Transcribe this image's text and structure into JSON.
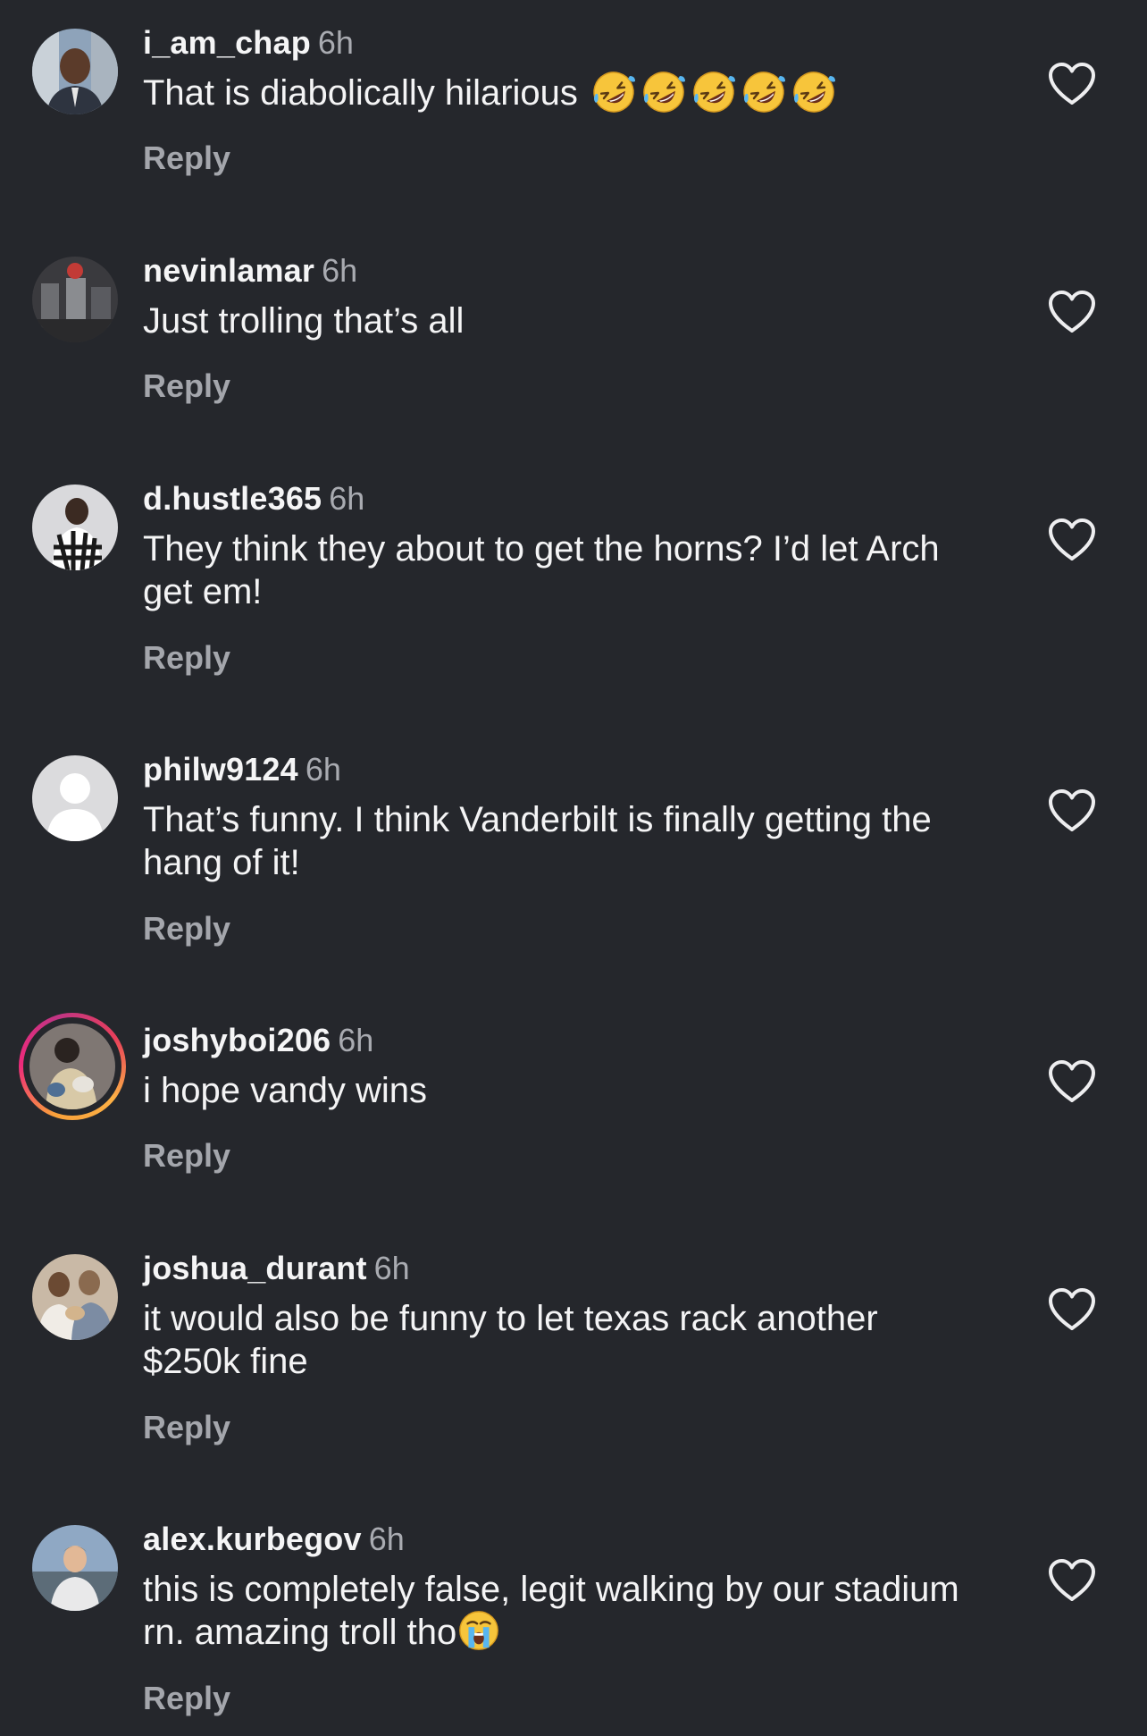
{
  "colors": {
    "background": "#25272c",
    "text": "#f4f4f5",
    "muted": "#a4a6ac",
    "story_ring": "#ee2a7b"
  },
  "icons": {
    "like": "heart-outline-icon",
    "laugh": "rolling-on-floor-laughing-emoji",
    "cry": "loudly-crying-face-emoji"
  },
  "comments": [
    {
      "username": "i_am_chap",
      "time": "6h",
      "text": "That is diabolically hilarious",
      "emoji_count": 5,
      "reply_label": "Reply"
    },
    {
      "username": "nevinlamar",
      "time": "6h",
      "text": "Just trolling that’s all",
      "reply_label": "Reply"
    },
    {
      "username": "d.hustle365",
      "time": "6h",
      "text": "They think they about to get the horns? I’d let Arch get em!",
      "reply_label": "Reply"
    },
    {
      "username": "philw9124",
      "time": "6h",
      "text": "That’s funny. I think Vanderbilt is finally getting the hang of it!",
      "reply_label": "Reply"
    },
    {
      "username": "joshyboi206",
      "time": "6h",
      "text": "i hope vandy wins",
      "reply_label": "Reply"
    },
    {
      "username": "joshua_durant",
      "time": "6h",
      "text": "it would also be funny to let texas rack another $250k fine",
      "reply_label": "Reply"
    },
    {
      "username": "alex.kurbegov",
      "time": "6h",
      "text": "this is completely false, legit walking by our stadium rn. amazing troll tho",
      "reply_label": "Reply"
    }
  ]
}
